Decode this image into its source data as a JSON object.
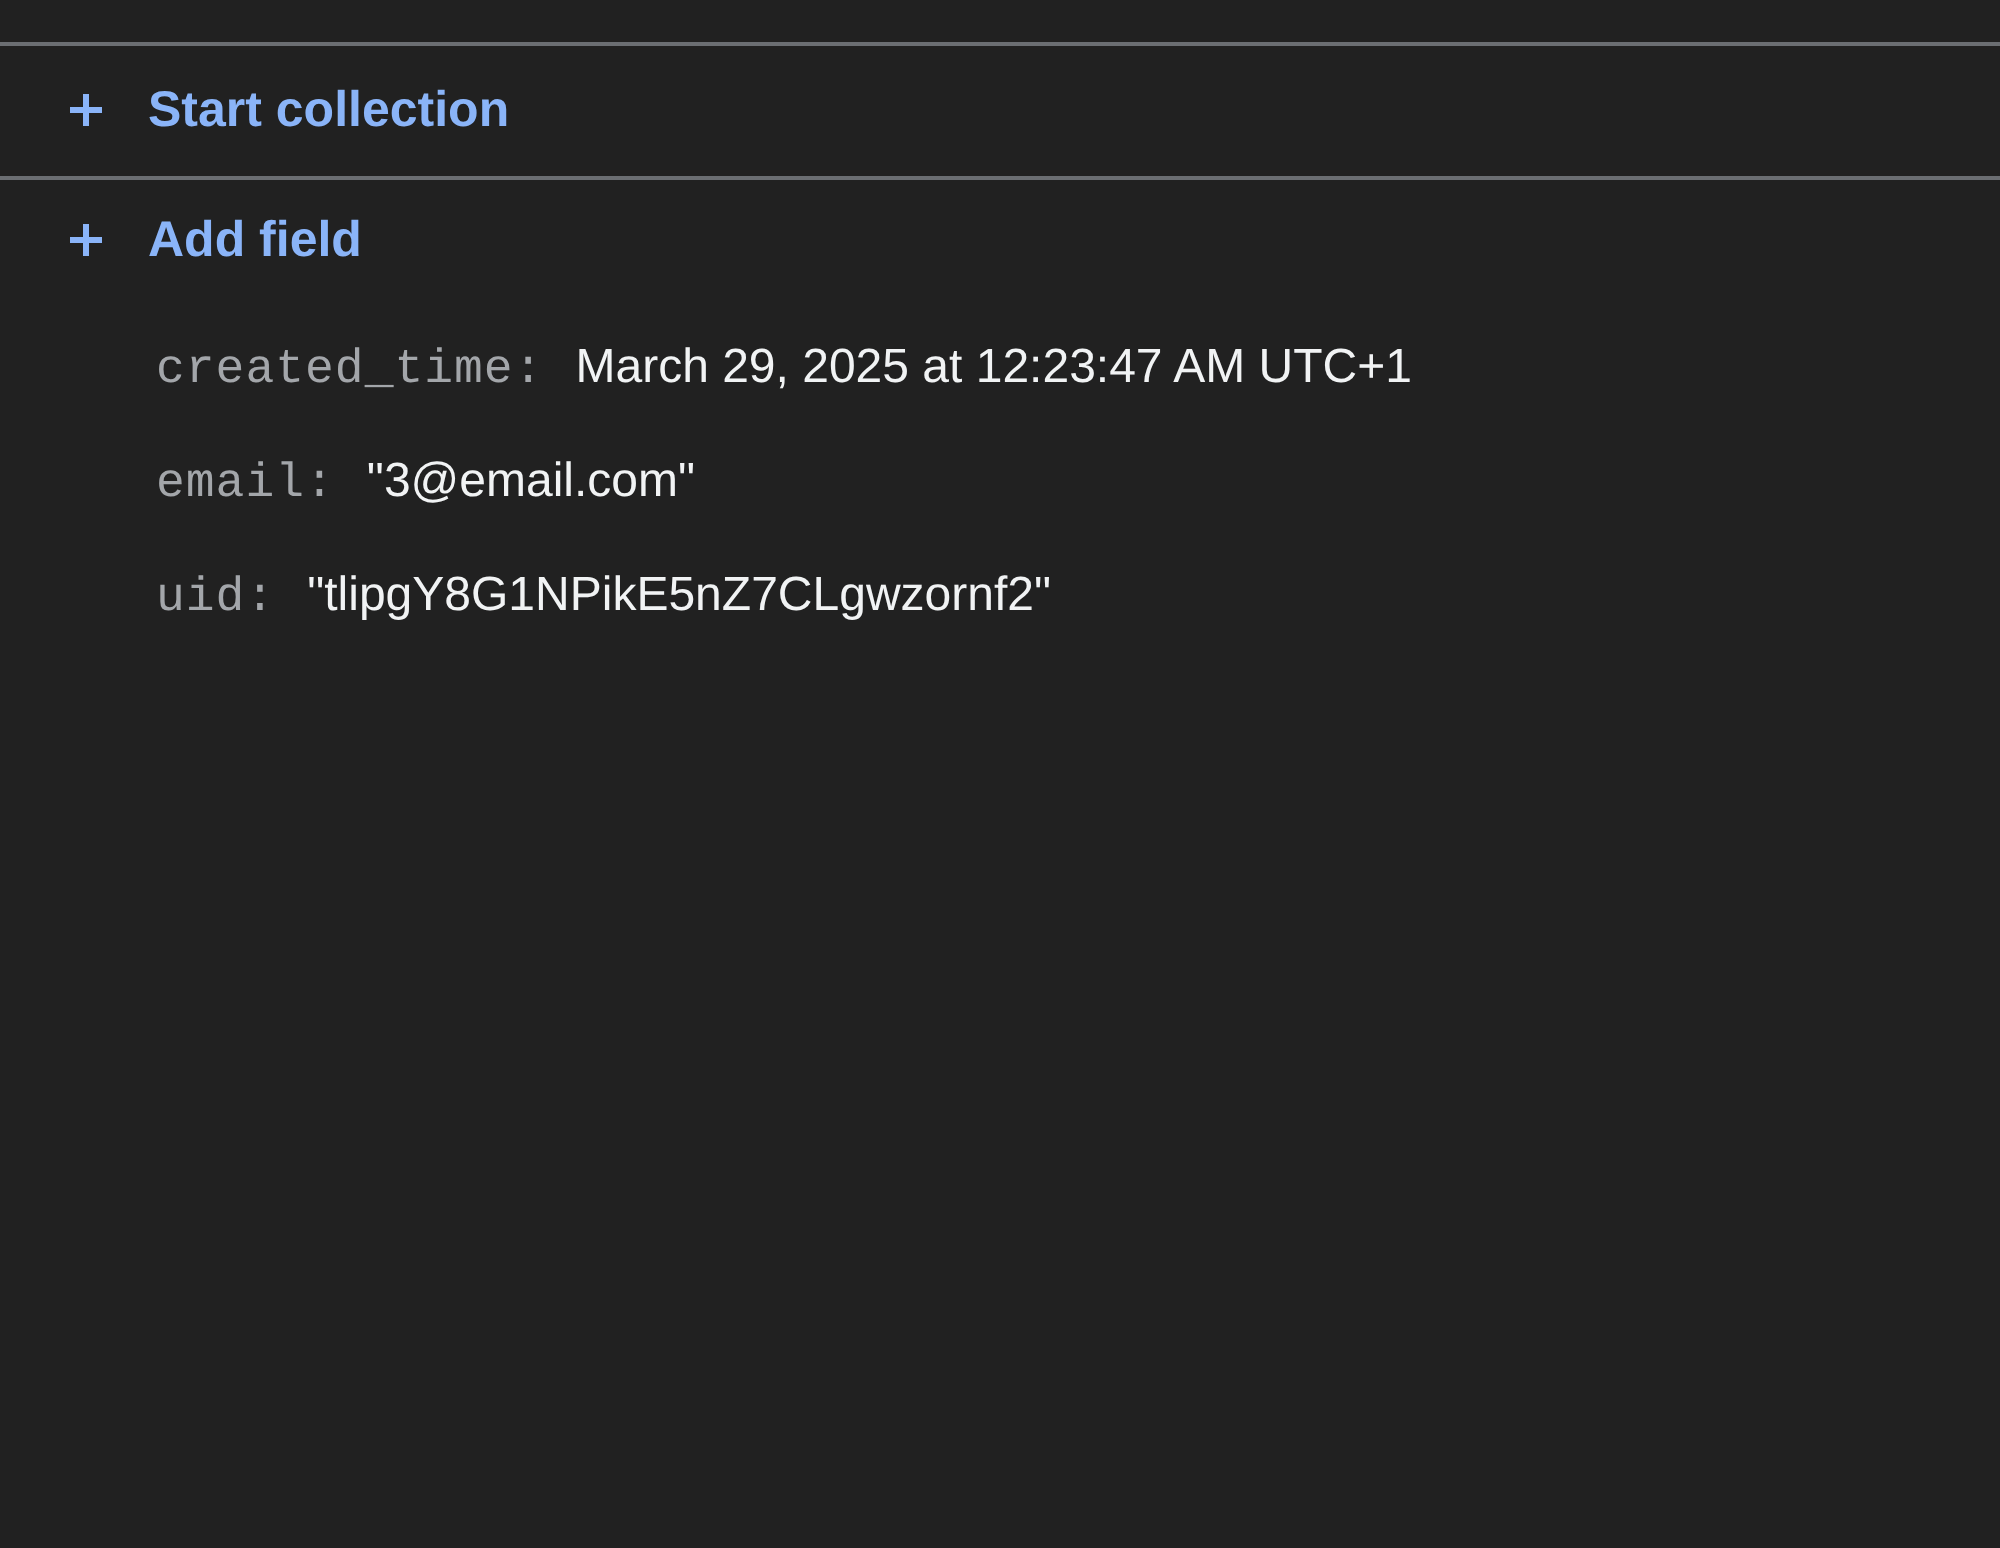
{
  "actions": [
    {
      "label": "Start collection"
    },
    {
      "label": "Add field"
    }
  ],
  "fields": [
    {
      "key": "created_time:",
      "value": "March 29, 2025 at 12:23:47 AM UTC+1"
    },
    {
      "key": "email:",
      "value": "\"3@email.com\""
    },
    {
      "key": "uid:",
      "value": "\"tlipgY8G1NPikE5nZ7CLgwzornf2\""
    }
  ]
}
